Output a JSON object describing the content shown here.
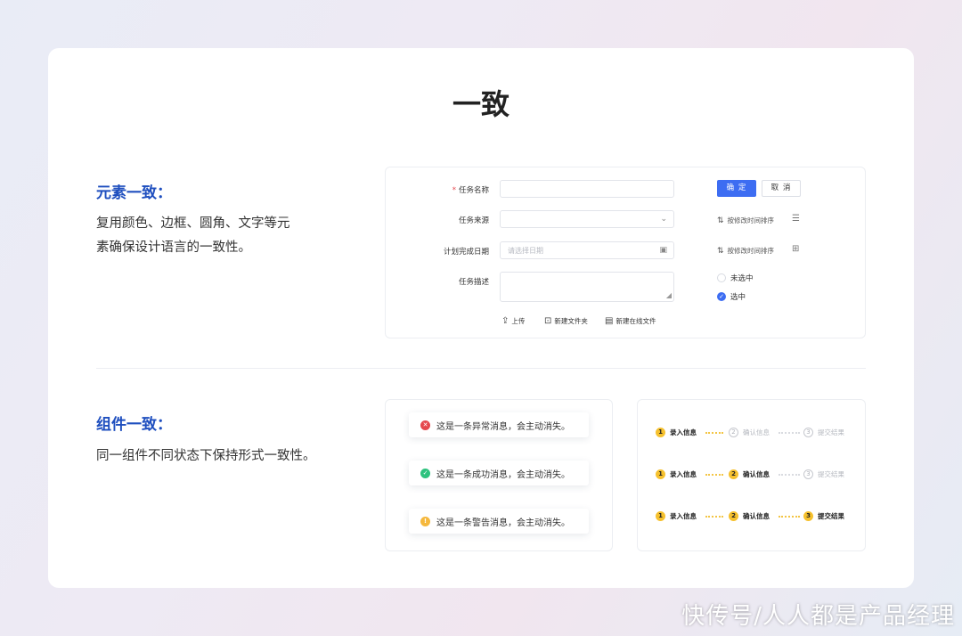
{
  "page_title": "一致",
  "section1": {
    "heading": "元素一致：",
    "desc_line1": "复用颜色、边框、圆角、文字等元",
    "desc_line2": "素确保设计语言的一致性。"
  },
  "section2": {
    "heading": "组件一致：",
    "desc": "同一组件不同状态下保持形式一致性。"
  },
  "form": {
    "fields": [
      {
        "label": "任务名称",
        "required": true,
        "value": "",
        "placeholder": ""
      },
      {
        "label": "任务来源",
        "value": "",
        "placeholder": ""
      },
      {
        "label": "计划完成日期",
        "placeholder": "请选择日期"
      },
      {
        "label": "任务描述",
        "value": ""
      }
    ],
    "required_mark": "*",
    "confirm_label": "确 定",
    "cancel_label": "取 消",
    "sort_items": [
      "按修改时间排序",
      "按修改时间排序"
    ],
    "radios": [
      {
        "label": "未选中",
        "checked": false
      },
      {
        "label": "选中",
        "checked": true
      }
    ],
    "actions": [
      "上传",
      "新建文件夹",
      "新建在线文件"
    ]
  },
  "messages": [
    {
      "type": "error",
      "text": "这是一条异常消息，会主动消失。",
      "color": "#e5484d",
      "glyph": "✕"
    },
    {
      "type": "success",
      "text": "这是一条成功消息，会主动消失。",
      "color": "#2ec27e",
      "glyph": "✓"
    },
    {
      "type": "warning",
      "text": "这是一条警告消息，会主动消失。",
      "color": "#f5b83d",
      "glyph": "!"
    }
  ],
  "steps": {
    "labels": [
      "录入信息",
      "确认信息",
      "提交结果"
    ],
    "numbers": [
      "1",
      "2",
      "3"
    ],
    "accent_color": "#f6c12e",
    "rows_completed": [
      1,
      2,
      3
    ]
  },
  "watermark": "快传号/人人都是产品经理"
}
